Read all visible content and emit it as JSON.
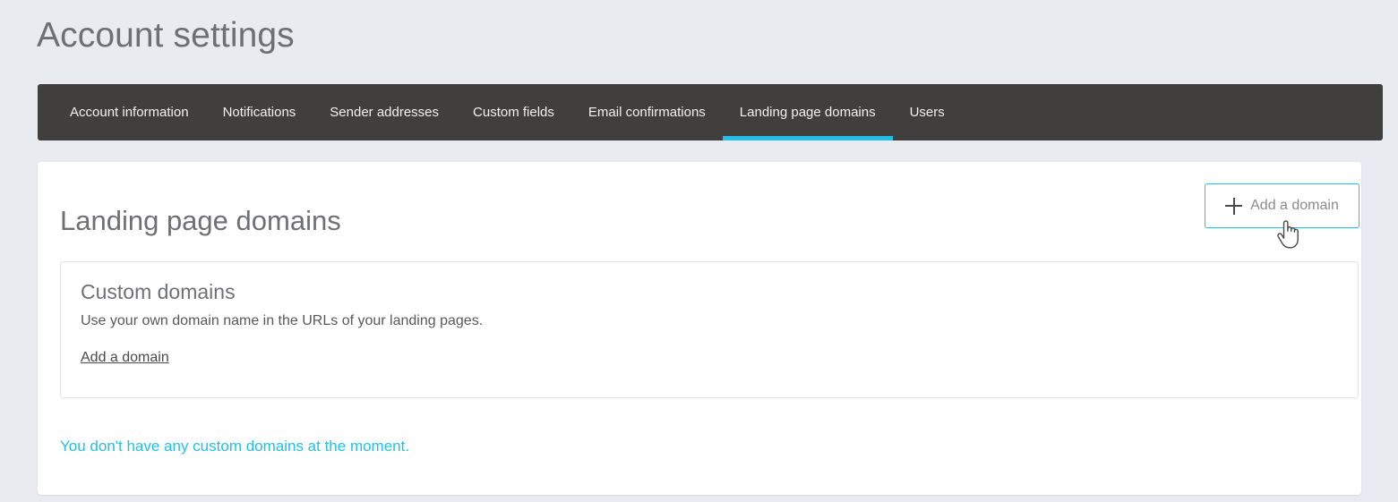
{
  "page": {
    "title": "Account settings",
    "background_color": "#e8ecf1",
    "accent_color": "#22c0e8"
  },
  "nav": {
    "background_color": "#403f3d",
    "active_indicator_color": "#22c0e8",
    "tabs": [
      {
        "label": "Account information",
        "active": false
      },
      {
        "label": "Notifications",
        "active": false
      },
      {
        "label": "Sender addresses",
        "active": false
      },
      {
        "label": "Custom fields",
        "active": false
      },
      {
        "label": "Email confirmations",
        "active": false
      },
      {
        "label": "Landing page domains",
        "active": true
      },
      {
        "label": "Users",
        "active": false
      }
    ]
  },
  "main": {
    "heading": "Landing page domains",
    "add_button": {
      "label": "Add a domain",
      "icon": "plus-icon",
      "border_color": "#22c0e8"
    },
    "custom_domains_box": {
      "title": "Custom domains",
      "description": "Use your own domain name in the URLs of your landing pages.",
      "link_label": "Add a domain"
    },
    "status_message": "You don't have any custom domains at the moment."
  },
  "cursor": {
    "icon": "pointer-hand-cursor"
  }
}
